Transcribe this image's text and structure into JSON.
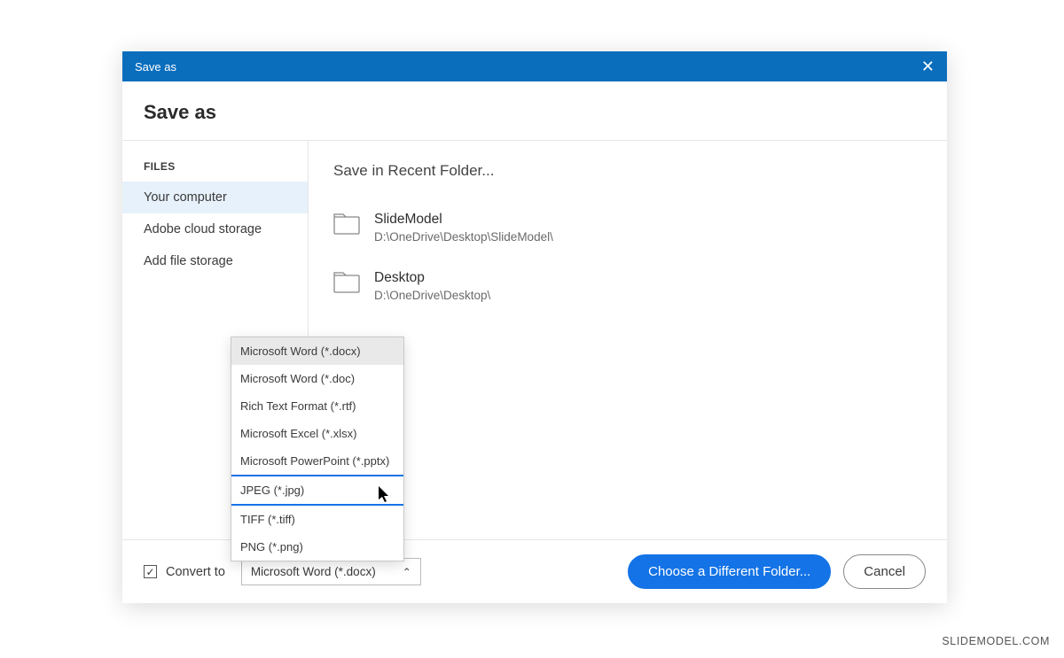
{
  "titlebar": {
    "title": "Save as"
  },
  "header": {
    "title": "Save as"
  },
  "sidebar": {
    "heading": "FILES",
    "items": [
      {
        "label": "Your computer",
        "active": true
      },
      {
        "label": "Adobe cloud storage",
        "active": false
      },
      {
        "label": "Add file storage",
        "active": false
      }
    ]
  },
  "main": {
    "title": "Save in Recent Folder...",
    "folders": [
      {
        "name": "SlideModel",
        "path": "D:\\OneDrive\\Desktop\\SlideModel\\"
      },
      {
        "name": "Desktop",
        "path": "D:\\OneDrive\\Desktop\\"
      }
    ]
  },
  "footer": {
    "convert_label": "Convert to",
    "format_selected": "Microsoft Word (*.docx)",
    "choose_button": "Choose a Different Folder...",
    "cancel_button": "Cancel"
  },
  "dropdown": {
    "options": [
      "Microsoft Word (*.docx)",
      "Microsoft Word (*.doc)",
      "Rich Text Format (*.rtf)",
      "Microsoft Excel (*.xlsx)",
      "Microsoft PowerPoint (*.pptx)",
      "JPEG (*.jpg)",
      "TIFF (*.tiff)",
      "PNG (*.png)"
    ]
  },
  "watermark": "SLIDEMODEL.COM"
}
